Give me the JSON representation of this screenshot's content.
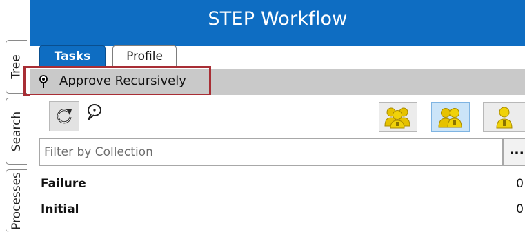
{
  "side_tabs": [
    {
      "label": "Tree"
    },
    {
      "label": "Search"
    },
    {
      "label": "Processes"
    }
  ],
  "window": {
    "title": "STEP Workflow"
  },
  "tabs": [
    {
      "label": "Tasks",
      "active": true
    },
    {
      "label": "Profile",
      "active": false
    }
  ],
  "selected_state": {
    "label": "Approve Recursively",
    "icon": "pin-icon"
  },
  "toolbar": {
    "refresh_icon": "refresh-icon",
    "comment_icon": "speech-bubble-icon",
    "user_filter_buttons": [
      {
        "icon": "users-group-icon",
        "pressed": false
      },
      {
        "icon": "users-group-icon",
        "pressed": true
      },
      {
        "icon": "user-icon",
        "pressed": false
      }
    ]
  },
  "filter": {
    "placeholder": "Filter by Collection",
    "value": "",
    "browse_label": "..."
  },
  "states": [
    {
      "name": "Failure",
      "count": "0"
    },
    {
      "name": "Initial",
      "count": "0"
    }
  ],
  "colors": {
    "title_bar": "#0e6dc2",
    "header_row": "#c9c9c9",
    "highlight_border": "#a82e35",
    "user_icon": "#e6c200"
  }
}
